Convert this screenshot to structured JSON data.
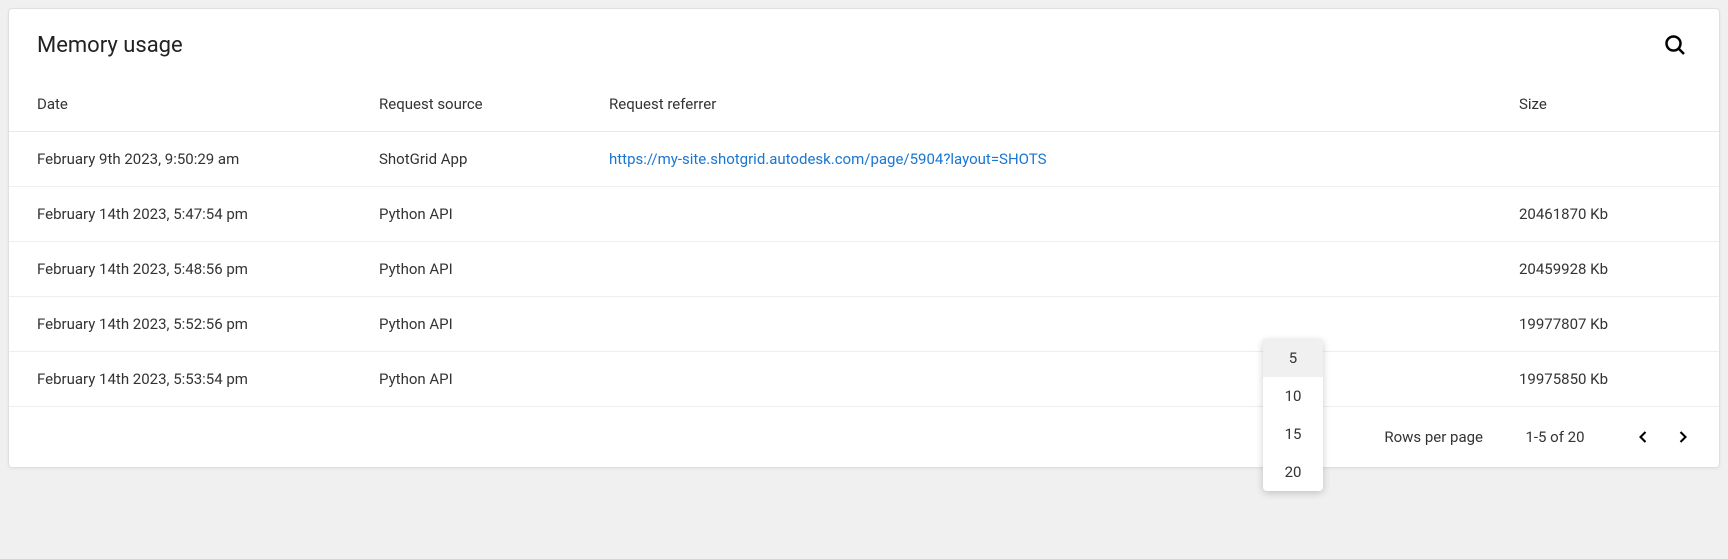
{
  "title": "Memory usage",
  "columns": {
    "date": "Date",
    "source": "Request source",
    "referrer": "Request referrer",
    "size": "Size"
  },
  "rows": [
    {
      "date": "February 9th 2023, 9:50:29 am",
      "source": "ShotGrid App",
      "referrer": "https://my-site.shotgrid.autodesk.com/page/5904?layout=SHOTS",
      "size": ""
    },
    {
      "date": "February 14th 2023, 5:47:54 pm",
      "source": "Python API",
      "referrer": "",
      "size": "20461870 Kb"
    },
    {
      "date": "February 14th 2023, 5:48:56 pm",
      "source": "Python API",
      "referrer": "",
      "size": "20459928 Kb"
    },
    {
      "date": "February 14th 2023, 5:52:56 pm",
      "source": "Python API",
      "referrer": "",
      "size": "19977807 Kb"
    },
    {
      "date": "February 14th 2023, 5:53:54 pm",
      "source": "Python API",
      "referrer": "",
      "size": "19975850 Kb"
    }
  ],
  "pagination": {
    "rows_label": "Rows per page",
    "range": "1-5 of 20",
    "options": [
      "5",
      "10",
      "15",
      "20"
    ],
    "selected": "5"
  }
}
